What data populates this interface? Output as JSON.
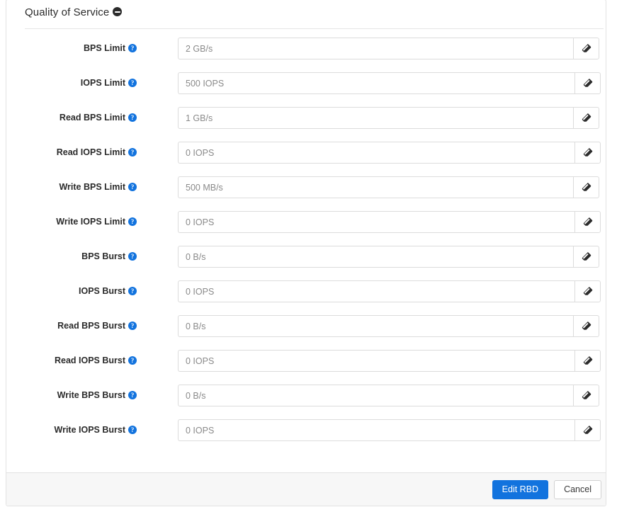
{
  "card": {
    "title": "Quality of Service",
    "collapse_icon": "minus-circle-icon",
    "collapsed": false
  },
  "form": {
    "help_icon_glyph": "?",
    "erase_icon": "eraser-icon",
    "rows": [
      {
        "label": "BPS Limit",
        "value": "",
        "placeholder": "2 GB/s"
      },
      {
        "label": "IOPS Limit",
        "value": "",
        "placeholder": "500 IOPS"
      },
      {
        "label": "Read BPS Limit",
        "value": "",
        "placeholder": "1 GB/s"
      },
      {
        "label": "Read IOPS Limit",
        "value": "",
        "placeholder": "0 IOPS"
      },
      {
        "label": "Write BPS Limit",
        "value": "",
        "placeholder": "500 MB/s"
      },
      {
        "label": "Write IOPS Limit",
        "value": "",
        "placeholder": "0 IOPS"
      },
      {
        "label": "BPS Burst",
        "value": "",
        "placeholder": "0 B/s"
      },
      {
        "label": "IOPS Burst",
        "value": "",
        "placeholder": "0 IOPS"
      },
      {
        "label": "Read BPS Burst",
        "value": "",
        "placeholder": "0 B/s"
      },
      {
        "label": "Read IOPS Burst",
        "value": "",
        "placeholder": "0 IOPS"
      },
      {
        "label": "Write BPS Burst",
        "value": "",
        "placeholder": "0 B/s"
      },
      {
        "label": "Write IOPS Burst",
        "value": "",
        "placeholder": "0 IOPS"
      }
    ]
  },
  "footer": {
    "submit_label": "Edit RBD",
    "cancel_label": "Cancel"
  },
  "colors": {
    "accent": "#1273de",
    "footer_bg": "#f7f7f7",
    "border": "#e3e3e3",
    "input_border": "#dcdcdc",
    "placeholder": "#8a8a8a",
    "label_text": "#2b2b2b"
  }
}
